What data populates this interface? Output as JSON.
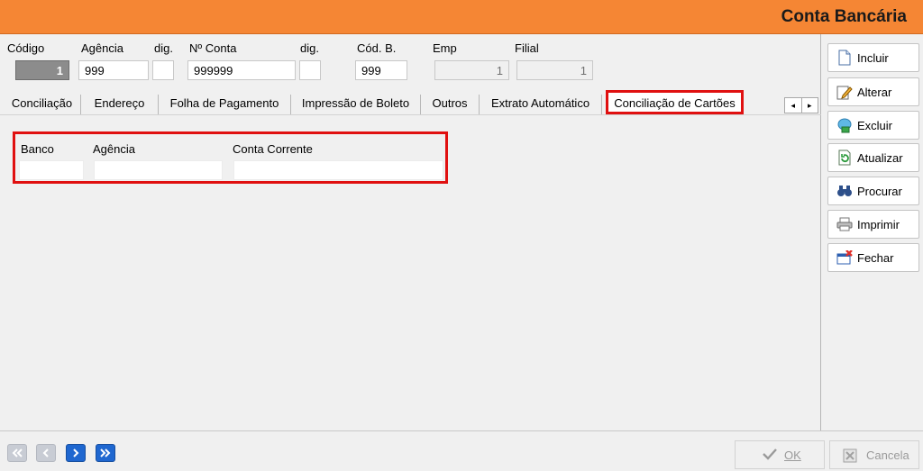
{
  "window": {
    "title": "Conta Bancária"
  },
  "header": {
    "labels": {
      "codigo": "Código",
      "agencia": "Agência",
      "dig1": "dig.",
      "numero_conta": "Nº Conta",
      "dig2": "dig.",
      "cod_banco": "Cód. B.",
      "emp": "Emp",
      "filial": "Filial"
    },
    "values": {
      "codigo": "1",
      "agencia": "999",
      "dig1": "",
      "numero_conta": "999999",
      "dig2": "",
      "cod_banco": "999",
      "emp": "1",
      "filial": "1"
    }
  },
  "tabs": [
    {
      "label": "Conciliação"
    },
    {
      "label": "Endereço"
    },
    {
      "label": "Folha de Pagamento"
    },
    {
      "label": "Impressão de Boleto"
    },
    {
      "label": "Outros"
    },
    {
      "label": "Extrato Automático"
    },
    {
      "label": "Conciliação de Cartões",
      "active": true
    }
  ],
  "tab_scroll": {
    "left": "◂",
    "right": "▸"
  },
  "card_panel": {
    "labels": {
      "banco": "Banco",
      "agencia": "Agência",
      "conta_corrente": "Conta Corrente"
    },
    "values": {
      "banco": "",
      "agencia": "",
      "conta_corrente": ""
    }
  },
  "sidebar": {
    "buttons": [
      {
        "label": "Incluir",
        "icon": "new-document-icon"
      },
      {
        "label": "Alterar",
        "icon": "edit-pencil-icon"
      },
      {
        "label": "Excluir",
        "icon": "delete-icon"
      },
      {
        "label": "Atualizar",
        "icon": "refresh-icon"
      },
      {
        "label": "Procurar",
        "icon": "binoculars-icon"
      },
      {
        "label": "Imprimir",
        "icon": "printer-icon"
      },
      {
        "label": "Fechar",
        "icon": "close-window-icon"
      }
    ]
  },
  "footer": {
    "ok_label": "OK",
    "cancel_label": "Cancela"
  },
  "colors": {
    "title_bar": "#f58634",
    "highlight": "#e01010",
    "nav_active": "#1f67d0"
  }
}
